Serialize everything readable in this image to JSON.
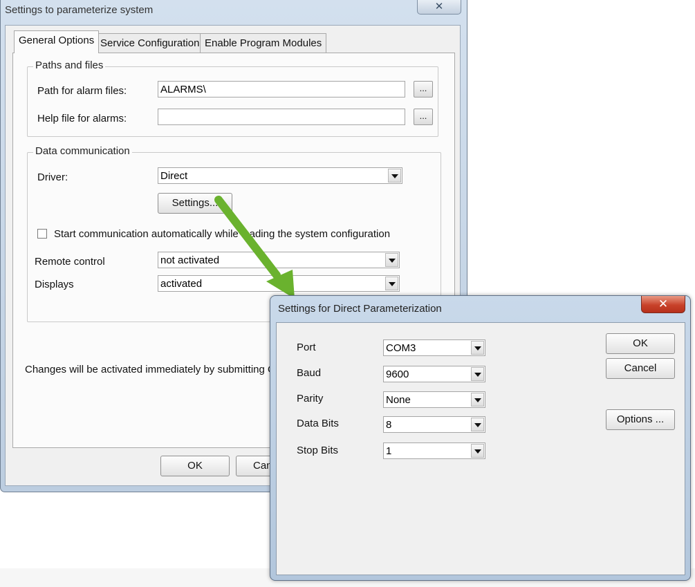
{
  "main_dialog": {
    "title": "Settings to parameterize system",
    "close_label": "✕",
    "tabs": [
      {
        "label": "General Options",
        "active": true
      },
      {
        "label": "Service Configuration",
        "active": false
      },
      {
        "label": "Enable Program Modules",
        "active": false
      }
    ],
    "paths_group": {
      "title": "Paths and files",
      "alarm_path_label": "Path for alarm files:",
      "alarm_path_value": "ALARMS\\",
      "help_file_label": "Help file for alarms:",
      "help_file_value": "",
      "browse_label": "..."
    },
    "comm_group": {
      "title": "Data communication",
      "driver_label": "Driver:",
      "driver_value": "Direct",
      "settings_button": "Settings...",
      "autostart_label": "Start communication automatically while loading the system configuration",
      "autostart_checked": false,
      "remote_label": "Remote control",
      "remote_value": "not activated",
      "displays_label": "Displays",
      "displays_value": "activated"
    },
    "note": "Changes will be activated immediately by submitting OK.",
    "ok_button": "OK",
    "cancel_button": "Can"
  },
  "direct_dialog": {
    "title": "Settings for Direct Parameterization",
    "close_label": "✕",
    "fields": {
      "port": {
        "label": "Port",
        "value": "COM3"
      },
      "baud": {
        "label": "Baud",
        "value": "9600"
      },
      "parity": {
        "label": "Parity",
        "value": "None"
      },
      "data_bits": {
        "label": "Data Bits",
        "value": "8"
      },
      "stop_bits": {
        "label": "Stop Bits",
        "value": "1"
      }
    },
    "ok_button": "OK",
    "cancel_button": "Cancel",
    "options_button": "Options ..."
  },
  "colors": {
    "annotation_arrow": "#6ab22e",
    "title_bar": "#c9d9ea",
    "close_button_red": "#c8422a"
  }
}
